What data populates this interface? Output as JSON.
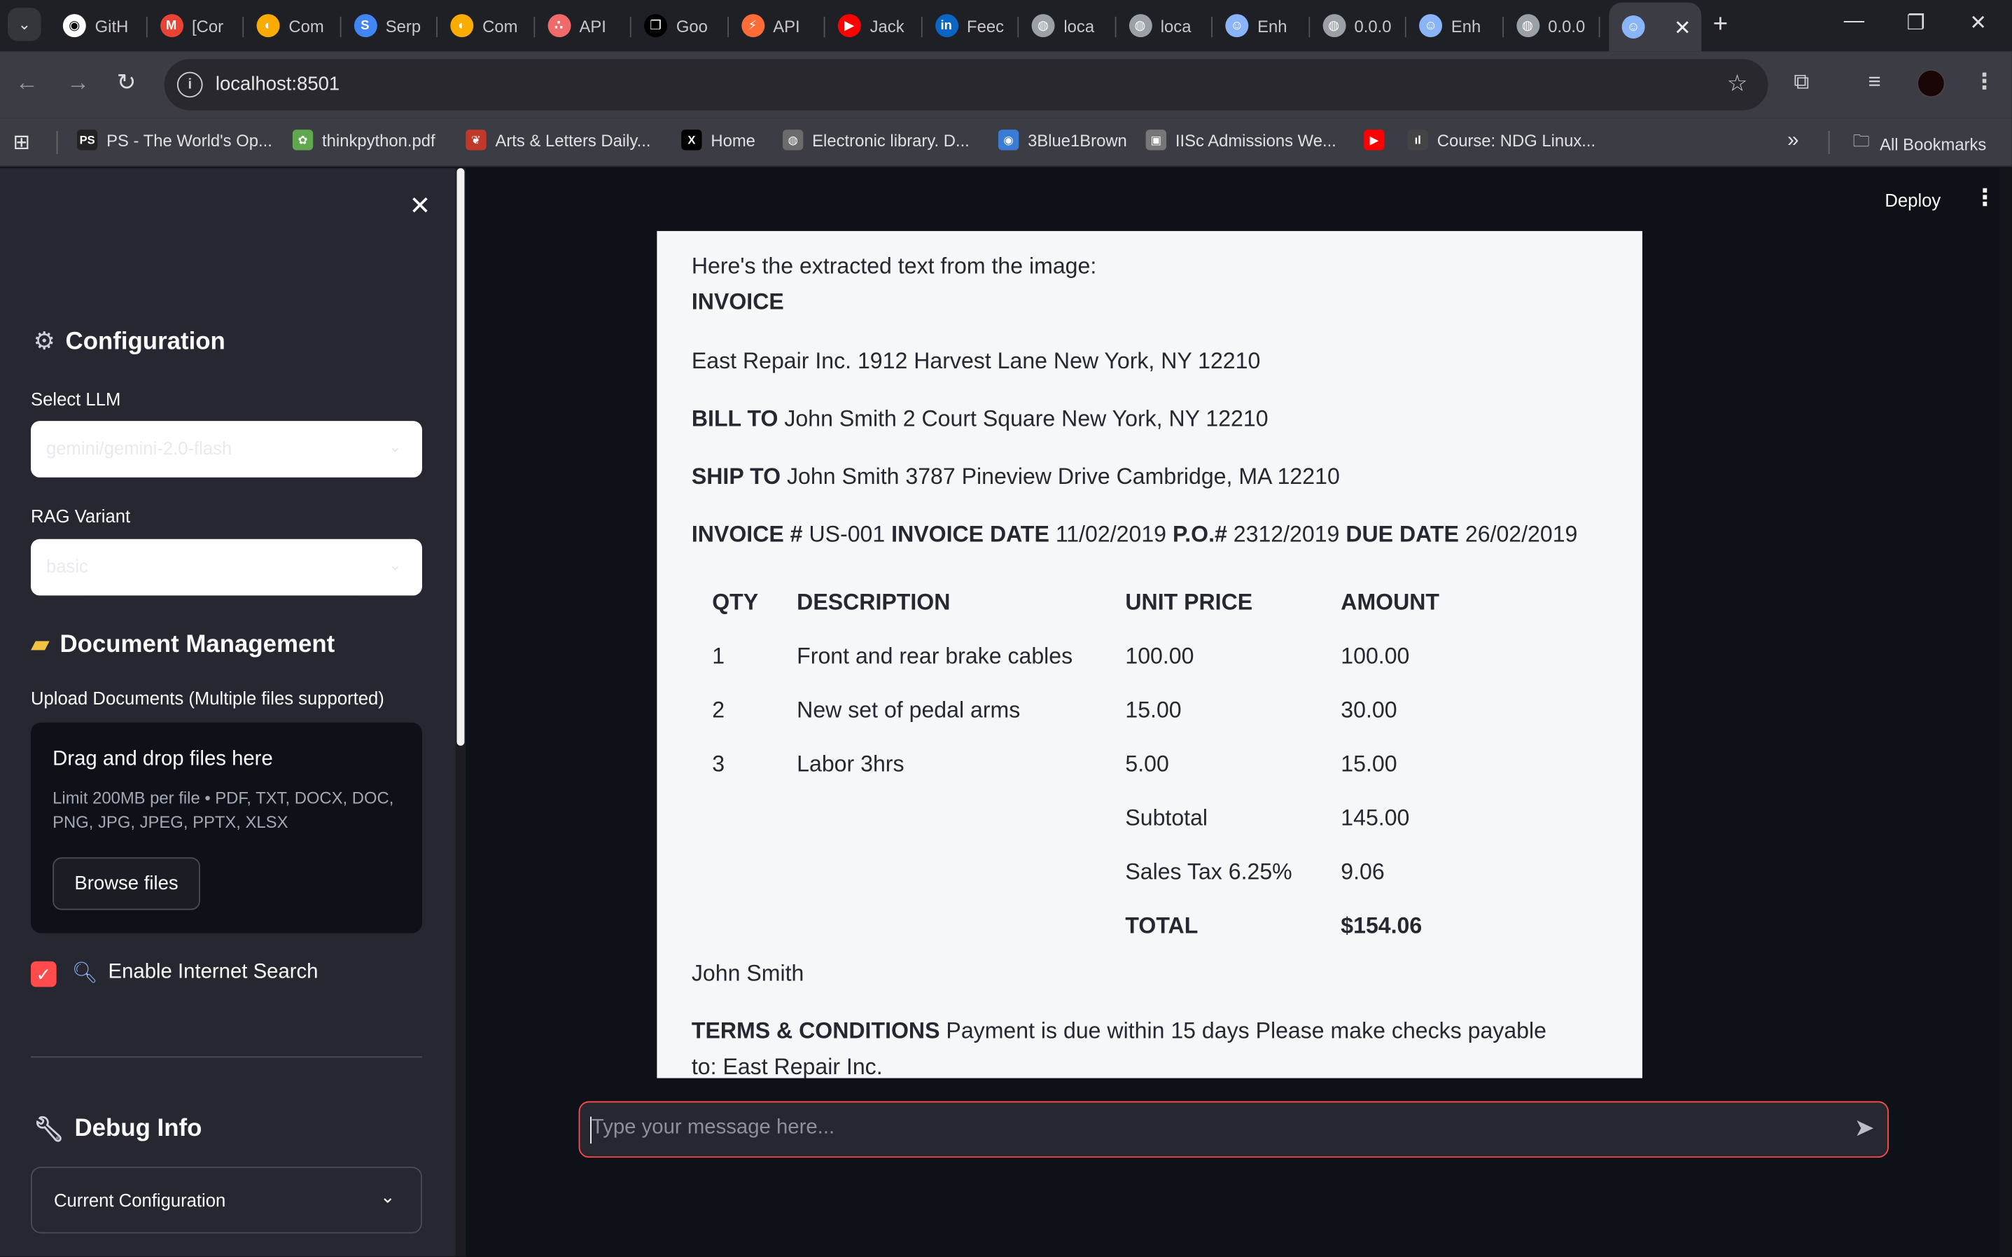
{
  "browser": {
    "tabs": [
      {
        "label": "GitH",
        "icon": "github-icon",
        "color": "#ffffff"
      },
      {
        "label": "[Cor",
        "icon": "gmail-icon",
        "color": "#ea4335"
      },
      {
        "label": "Com",
        "icon": "colab-icon",
        "color": "#f9ab00"
      },
      {
        "label": "Serp",
        "icon": "serp-icon",
        "color": "#4285f4"
      },
      {
        "label": "Com",
        "icon": "colab-icon",
        "color": "#f9ab00"
      },
      {
        "label": "API",
        "icon": "dots-icon",
        "color": "#f06a6a"
      },
      {
        "label": "Goo",
        "icon": "code-icon",
        "color": "#000000"
      },
      {
        "label": "API",
        "icon": "postman-icon",
        "color": "#ff6c37"
      },
      {
        "label": "Jack",
        "icon": "youtube-icon",
        "color": "#ff0000"
      },
      {
        "label": "Feec",
        "icon": "linkedin-icon",
        "color": "#0a66c2"
      },
      {
        "label": "loca",
        "icon": "globe-icon",
        "color": "#9aa0a6"
      },
      {
        "label": "loca",
        "icon": "globe-icon",
        "color": "#9aa0a6"
      },
      {
        "label": "Enh",
        "icon": "robot-icon",
        "color": "#8ab4f8"
      },
      {
        "label": "0.0.0",
        "icon": "globe-icon",
        "color": "#9aa0a6"
      },
      {
        "label": "Enh",
        "icon": "robot-icon",
        "color": "#8ab4f8"
      },
      {
        "label": "0.0.0",
        "icon": "globe-icon",
        "color": "#9aa0a6"
      }
    ],
    "url": "localhost:8501",
    "bookmarks": [
      {
        "label": "PS - The World's Op...",
        "icon": "ps-icon"
      },
      {
        "label": "thinkpython.pdf",
        "icon": "leaf-icon"
      },
      {
        "label": "Arts & Letters Daily...",
        "icon": "book-icon"
      },
      {
        "label": "Home",
        "icon": "x-icon"
      },
      {
        "label": "Electronic library. D...",
        "icon": "globe-icon"
      },
      {
        "label": "3Blue1Brown",
        "icon": "eye-icon"
      },
      {
        "label": "IISc Admissions We...",
        "icon": "iisc-icon"
      },
      {
        "label": "",
        "icon": "youtube-icon"
      },
      {
        "label": "Course: NDG Linux...",
        "icon": "cisco-icon"
      }
    ],
    "all_bookmarks": "All Bookmarks"
  },
  "sidebar": {
    "config_title": "Configuration",
    "select_llm_label": "Select LLM",
    "select_llm_value": "gemini/gemini-2.0-flash",
    "rag_label": "RAG Variant",
    "rag_value": "basic",
    "doc_title": "Document Management",
    "upload_label": "Upload Documents (Multiple files supported)",
    "dz_title": "Drag and drop files here",
    "dz_note": "Limit 200MB per file • PDF, TXT, DOCX, DOC, PNG, JPG, JPEG, PPTX, XLSX",
    "browse": "Browse files",
    "internet_search": "Enable Internet Search",
    "debug_title": "Debug Info",
    "current_config": "Current Configuration"
  },
  "main": {
    "deploy": "Deploy",
    "intro": "Here's the extracted text from the image:",
    "invoice_title": "INVOICE",
    "from": "East Repair Inc. 1912 Harvest Lane New York, NY 12210",
    "bill_to_label": "BILL TO",
    "bill_to": "John Smith 2 Court Square New York, NY 12210",
    "ship_to_label": "SHIP TO",
    "ship_to": "John Smith 3787 Pineview Drive Cambridge, MA 12210",
    "inv_no_label": "INVOICE #",
    "inv_no": "US-001",
    "inv_date_label": "INVOICE DATE",
    "inv_date": "11/02/2019",
    "po_label": "P.O.#",
    "po": "2312/2019",
    "due_label": "DUE DATE",
    "due": "26/02/2019",
    "table": {
      "headers": [
        "QTY",
        "DESCRIPTION",
        "UNIT PRICE",
        "AMOUNT"
      ],
      "rows": [
        [
          "1",
          "Front and rear brake cables",
          "100.00",
          "100.00"
        ],
        [
          "2",
          "New set of pedal arms",
          "15.00",
          "30.00"
        ],
        [
          "3",
          "Labor 3hrs",
          "5.00",
          "15.00"
        ]
      ],
      "subtotal_label": "Subtotal",
      "subtotal": "145.00",
      "tax_label": "Sales Tax 6.25%",
      "tax": "9.06",
      "total_label": "TOTAL",
      "total": "$154.06"
    },
    "signature": "John Smith",
    "terms_label": "TERMS & CONDITIONS",
    "terms_line1": "Payment is due within 15 days Please make checks payable",
    "terms_line2": "to: East Repair Inc.",
    "chat_placeholder": "Type your message here..."
  },
  "colors": {
    "accent": "#ff4b4b",
    "sidebar_bg": "#262730",
    "main_bg": "#0e1117"
  }
}
